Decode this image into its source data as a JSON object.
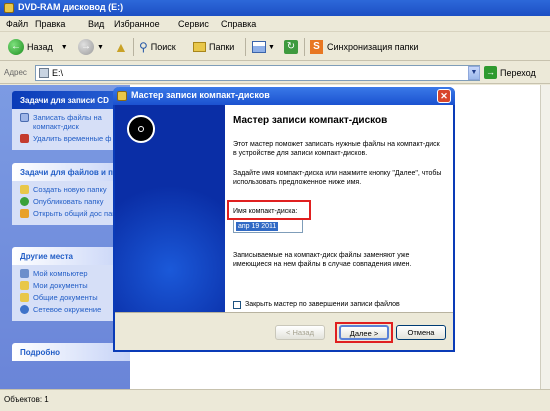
{
  "window": {
    "title": "DVD-RAM дисковод (E:)"
  },
  "menu": [
    "Файл",
    "Правка",
    "Вид",
    "Избранное",
    "Сервис",
    "Справка"
  ],
  "toolbar": {
    "back": "Назад",
    "search": "Поиск",
    "folders": "Папки",
    "sync": "Синхронизация папки"
  },
  "address": {
    "label": "Адрес",
    "value": "E:\\",
    "go": "Переход"
  },
  "left": {
    "panel1": {
      "title": "Задачи для записи CD",
      "items": [
        "Записать файлы на компакт-диск",
        "Удалить временные ф"
      ]
    },
    "panel2": {
      "title": "Задачи для файлов и п",
      "items": [
        "Создать новую папку",
        "Опубликовать папку",
        "Открыть общий дос папке"
      ]
    },
    "panel3": {
      "title": "Другие места",
      "items": [
        "Мой компьютер",
        "Мои документы",
        "Общие документы",
        "Сетевое окружение"
      ]
    },
    "panel4": {
      "title": "Подробно"
    }
  },
  "status": {
    "text": "Объектов: 1"
  },
  "dialog": {
    "title": "Мастер записи компакт-дисков",
    "heading": "Мастер записи компакт-дисков",
    "intro": "Этот мастер поможет записать нужные файлы на компакт-диск в устройстве для записи компакт-дисков.",
    "instruction": "Задайте имя компакт-диска или нажмите кнопку \"Далее\", чтобы использовать предложенное ниже имя.",
    "name_label": "Имя компакт-диска:",
    "name_value": "апр 19 2011",
    "warning": "Записываемые на компакт-диск файлы заменяют уже имеющиеся на нем файлы в случае совпадения имен.",
    "checkbox_label": "Закрыть мастер по завершении записи файлов",
    "buttons": {
      "back": "< Назад",
      "next": "Далее >",
      "cancel": "Отмена"
    }
  }
}
